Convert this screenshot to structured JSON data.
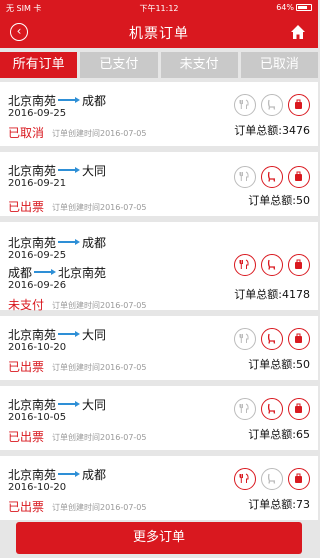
{
  "status_bar": {
    "carrier": "无 SIM 卡",
    "time": "下午11:12",
    "battery": "64%"
  },
  "header": {
    "title": "机票订单"
  },
  "tabs": [
    {
      "label": "所有订单",
      "active": true
    },
    {
      "label": "已支付",
      "active": false
    },
    {
      "label": "未支付",
      "active": false
    },
    {
      "label": "已取消",
      "active": false
    }
  ],
  "orders": [
    {
      "legs": [
        {
          "from": "北京南苑",
          "to": "成都",
          "date": "2016-09-25"
        }
      ],
      "status": "已取消",
      "created": "订单创建时间2016-07-05",
      "total": "订单总额:3476",
      "services": [
        "off",
        "off",
        "on"
      ]
    },
    {
      "legs": [
        {
          "from": "北京南苑",
          "to": "大同",
          "date": "2016-09-21"
        }
      ],
      "status": "已出票",
      "created": "订单创建时间2016-07-05",
      "total": "订单总额:50",
      "services": [
        "off",
        "on",
        "on"
      ]
    },
    {
      "legs": [
        {
          "from": "北京南苑",
          "to": "成都",
          "date": "2016-09-25"
        },
        {
          "from": "成都",
          "to": "北京南苑",
          "date": "2016-09-26"
        }
      ],
      "status": "未支付",
      "created": "订单创建时间2016-07-05",
      "total": "订单总额:4178",
      "services": [
        "on",
        "on",
        "on"
      ]
    },
    {
      "legs": [
        {
          "from": "北京南苑",
          "to": "大同",
          "date": "2016-10-20"
        }
      ],
      "status": "已出票",
      "created": "订单创建时间2016-07-05",
      "total": "订单总额:50",
      "services": [
        "off",
        "on",
        "on"
      ]
    },
    {
      "legs": [
        {
          "from": "北京南苑",
          "to": "大同",
          "date": "2016-10-05"
        }
      ],
      "status": "已出票",
      "created": "订单创建时间2016-07-05",
      "total": "订单总额:65",
      "services": [
        "off",
        "on",
        "on"
      ]
    },
    {
      "legs": [
        {
          "from": "北京南苑",
          "to": "成都",
          "date": "2016-10-20"
        }
      ],
      "status": "已出票",
      "created": "订单创建时间2016-07-05",
      "total": "订单总额:73",
      "services": [
        "on",
        "off",
        "on"
      ]
    }
  ],
  "more_button": "更多订单",
  "icons": {
    "back": "chevron-left-icon",
    "home": "home-icon",
    "services": [
      "meal-icon",
      "seat-icon",
      "luggage-icon"
    ]
  },
  "colors": {
    "accent": "#d9181f",
    "arrow": "#2e8fd6"
  }
}
